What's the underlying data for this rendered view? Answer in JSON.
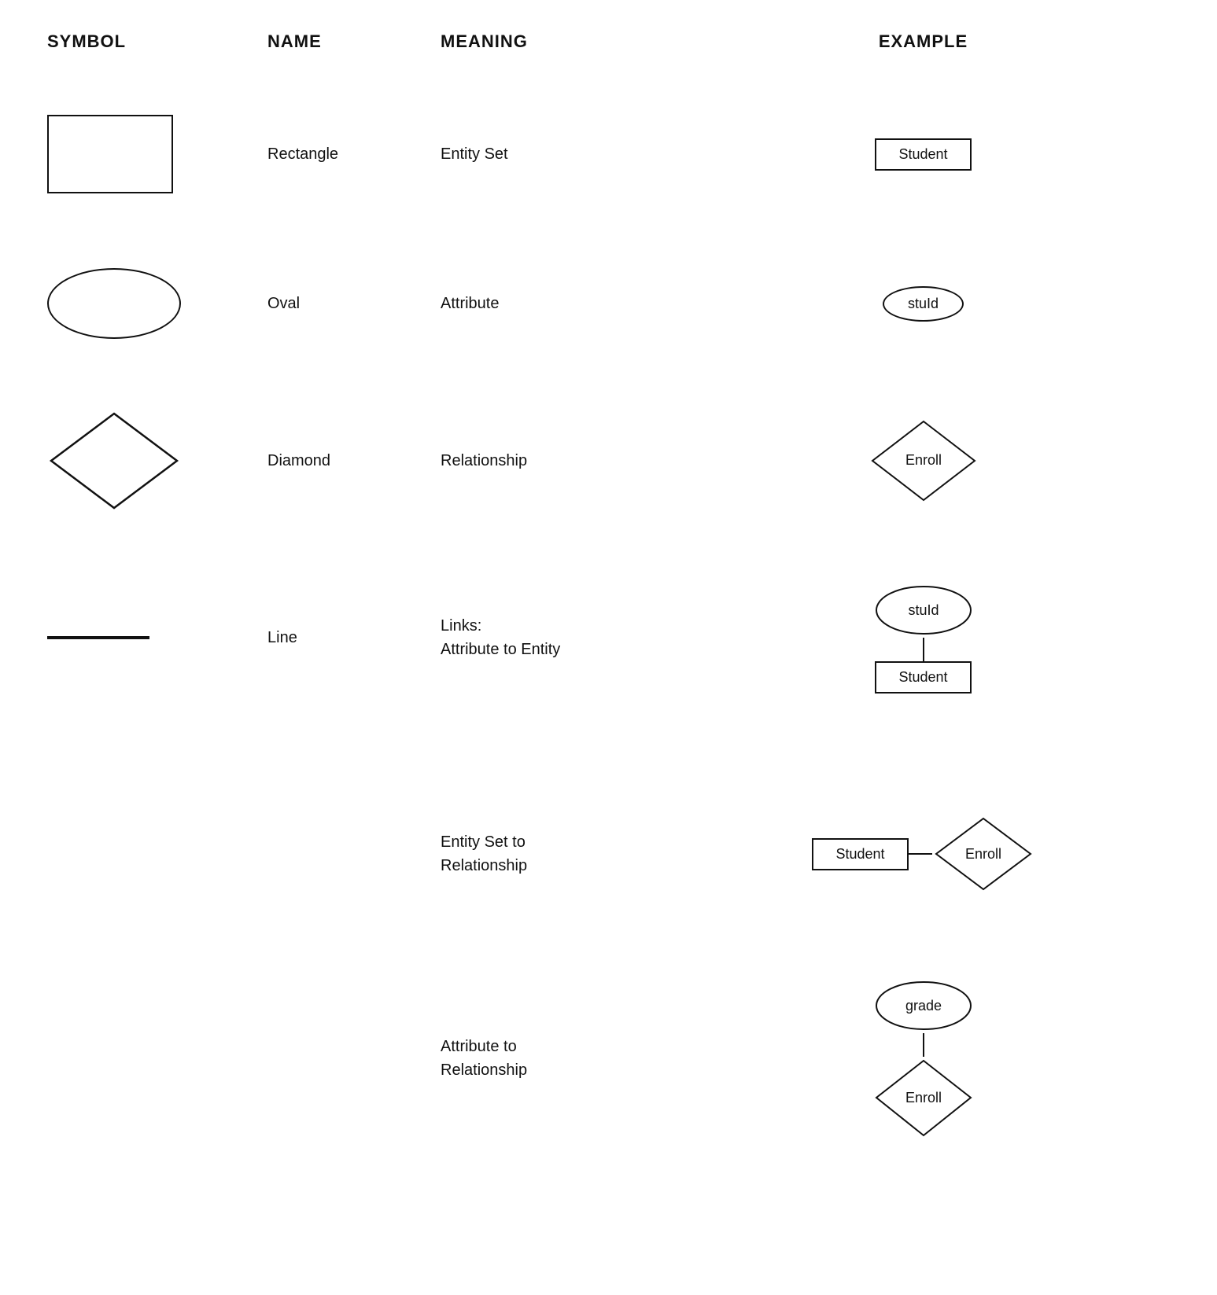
{
  "header": {
    "col1": "SYMBOL",
    "col2": "NAME",
    "col3": "MEANING",
    "col4": "EXAMPLE"
  },
  "rows": [
    {
      "id": "rectangle",
      "name": "Rectangle",
      "meaning": "Entity Set",
      "example_label": "Student",
      "example_type": "rect"
    },
    {
      "id": "oval",
      "name": "Oval",
      "meaning": "Attribute",
      "example_label": "stuId",
      "example_type": "oval"
    },
    {
      "id": "diamond",
      "name": "Diamond",
      "meaning": "Relationship",
      "example_label": "Enroll",
      "example_type": "diamond"
    },
    {
      "id": "line",
      "name": "Line",
      "meaning": "Links:\nAttribute to Entity",
      "example_type": "line-linked",
      "example_top": "stuId",
      "example_bottom": "Student"
    }
  ],
  "extra_rows": [
    {
      "id": "entity-set-to-relationship",
      "meaning": "Entity Set to\nRelationship",
      "example_type": "ent-rel",
      "example_left": "Student",
      "example_right": "Enroll"
    },
    {
      "id": "attribute-to-relationship",
      "meaning": "Attribute to\nRelationship",
      "example_type": "attr-rel",
      "example_top": "grade",
      "example_bottom": "Enroll"
    }
  ]
}
